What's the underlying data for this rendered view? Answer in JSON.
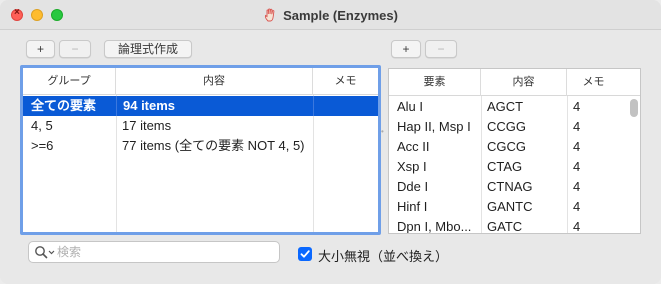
{
  "window": {
    "title": "Sample (Enzymes)",
    "title_icon": "hand-icon"
  },
  "left_toolbar": {
    "add_label": "+",
    "remove_label": "−",
    "logic_label": "論理式作成"
  },
  "right_toolbar": {
    "add_label": "+",
    "remove_label": "−"
  },
  "group_table": {
    "columns": [
      "グループ",
      "内容",
      "メモ"
    ],
    "rows": [
      {
        "group": "全ての要素",
        "content": "94 items",
        "memo": "",
        "selected": true
      },
      {
        "group": "4, 5",
        "content": "17 items",
        "memo": "",
        "selected": false
      },
      {
        "group": ">=6",
        "content": "77 items (全ての要素 NOT 4, 5)",
        "memo": "",
        "selected": false
      }
    ]
  },
  "element_table": {
    "columns": [
      "要素",
      "内容",
      "メモ"
    ],
    "rows": [
      {
        "element": "Alu I",
        "content": "AGCT",
        "memo": "4"
      },
      {
        "element": "Hap II, Msp I",
        "content": "CCGG",
        "memo": "4"
      },
      {
        "element": "Acc II",
        "content": "CGCG",
        "memo": "4"
      },
      {
        "element": "Xsp I",
        "content": "CTAG",
        "memo": "4"
      },
      {
        "element": "Dde I",
        "content": "CTNAG",
        "memo": "4"
      },
      {
        "element": "Hinf I",
        "content": "GANTC",
        "memo": "4"
      },
      {
        "element": "Dpn I, Mbo...",
        "content": "GATC",
        "memo": "4"
      }
    ]
  },
  "search": {
    "placeholder": "検索",
    "value": ""
  },
  "case_option": {
    "label": "大小無視（並べ換え）",
    "checked": true
  },
  "colors": {
    "selection": "#0a5ad6",
    "focus_ring": "#6f9fe8",
    "checkbox": "#0a68ff"
  }
}
